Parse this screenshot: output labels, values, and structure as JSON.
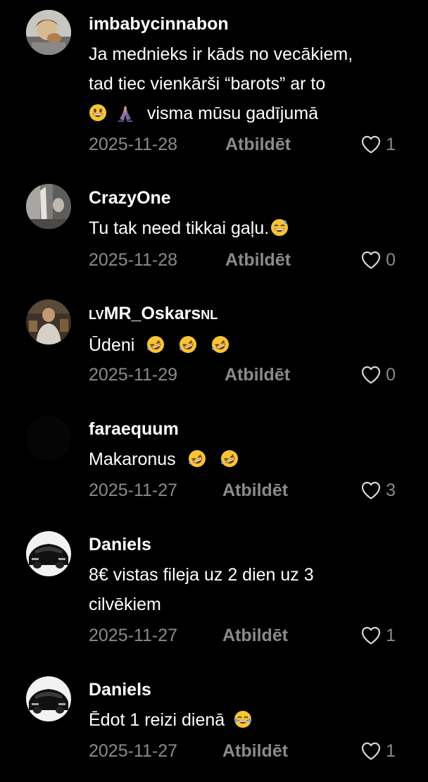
{
  "reply_label": "Atbildēt",
  "comments": [
    {
      "username": "imbabycinnabon",
      "text_lines": [
        "Ja mednieks ir kāds no vecākiem,",
        "tad tiec vienkārši “barots” ar to",
        "visma mūsu gadījumā"
      ],
      "date": "2025-11-28",
      "likes": "1"
    },
    {
      "username": "CrazyOne",
      "text_lines": [
        "Tu tak need tikkai gaļu."
      ],
      "date": "2025-11-28",
      "likes": "0"
    },
    {
      "username_prefix": "LV",
      "username": "MR_Oskars",
      "username_suffix": "NL",
      "text_lines": [
        "Ūdeni"
      ],
      "date": "2025-11-29",
      "likes": "0"
    },
    {
      "username": "faraequum",
      "text_lines": [
        "Makaronus"
      ],
      "date": "2025-11-27",
      "likes": "3"
    },
    {
      "username": "Daniels",
      "text_lines": [
        "8€ vistas fileja uz 2 dien uz 3",
        "cilvēkiem"
      ],
      "date": "2025-11-27",
      "likes": "1"
    },
    {
      "username": "Daniels",
      "text_lines": [
        "Ēdot 1 reizi dienā"
      ],
      "date": "2025-11-27",
      "likes": "1"
    }
  ]
}
